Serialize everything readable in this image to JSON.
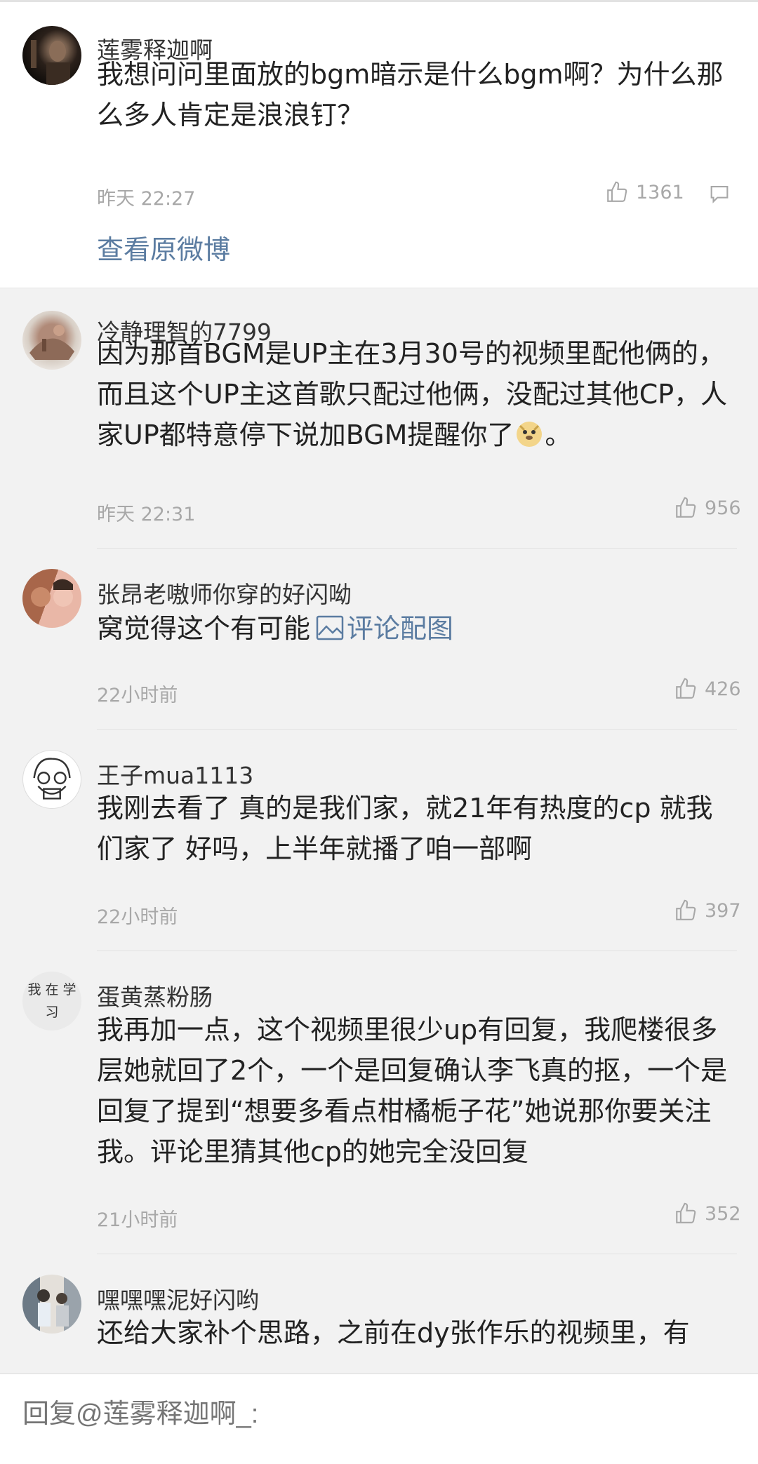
{
  "main_comment": {
    "username": "莲雾释迦啊_",
    "content": "我想问问里面放的bgm暗示是什么bgm啊？为什么那么多人肯定是浪浪钉？",
    "time": "昨天 22:27",
    "likes": "1361",
    "view_original": "查看原微博"
  },
  "replies": [
    {
      "username": "冷静理智的7799",
      "content_a": "因为那首BGM是UP主在3月30号的视频里配他俩的，而且这个UP主这首歌只配过他俩，没配过其他CP，人家UP都特意停下说加BGM提醒你了",
      "content_b": "。",
      "time": "昨天 22:31",
      "likes": "956"
    },
    {
      "username": "张昂老嗷师你穿的好闪呦",
      "content_a": "窝觉得这个有可能",
      "link": "评论配图",
      "time": "22小时前",
      "likes": "426"
    },
    {
      "username": "王子mua1113",
      "content_a": "我刚去看了 真的是我们家，就21年有热度的cp 就我们家了 好吗，上半年就播了咱一部啊",
      "time": "22小时前",
      "likes": "397"
    },
    {
      "username": "蛋黄蒸粉肠",
      "avatar_text": "我在学习",
      "content_a": "我再加一点，这个视频里很少up有回复，我爬楼很多层她就回了2个，一个是回复确认李飞真的抠，一个是回复了提到“想要多看点柑橘栀子花”她说那你要关注我。评论里猜其他cp的她完全没回复",
      "time": "21小时前",
      "likes": "352"
    },
    {
      "username": "嘿嘿嘿泥好闪哟",
      "content_a": "还给大家补个思路，之前在dy张作乐的视频里，有"
    }
  ],
  "reply_bar": {
    "placeholder": "回复@莲雾释迦啊_:"
  },
  "colors": {
    "link": "#5b7ca1",
    "meta": "#a8a8a8",
    "bg": "#f2f2f2"
  },
  "icons": [
    "thumbs-up-icon",
    "comment-bubble-icon",
    "image-icon",
    "doge-emoji"
  ]
}
